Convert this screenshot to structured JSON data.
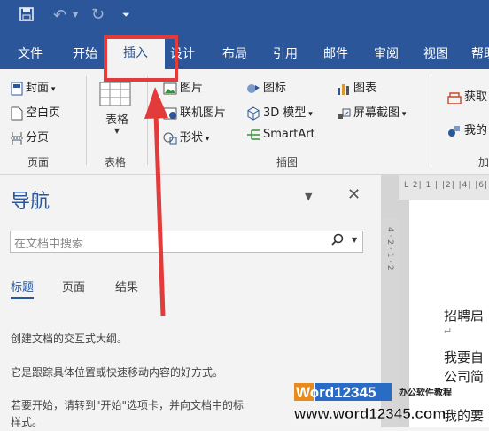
{
  "qat": {
    "save_icon": "save-icon",
    "undo_icon": "undo-icon",
    "redo_icon": "redo-icon",
    "customize_icon": "customize-qat-icon"
  },
  "tabs": [
    "文件",
    "开始",
    "插入",
    "设计",
    "布局",
    "引用",
    "邮件",
    "审阅",
    "视图",
    "帮助"
  ],
  "active_tab": "插入",
  "ribbon": {
    "pages": {
      "cover": "封面",
      "blank": "空白页",
      "break": "分页",
      "label": "页面"
    },
    "tables": {
      "table": "表格",
      "label": "表格"
    },
    "illustrations": {
      "pictures": "图片",
      "online_pictures": "联机图片",
      "shapes": "形状",
      "icons": "图标",
      "models3d": "3D 模型",
      "smartart": "SmartArt",
      "chart": "图表",
      "screenshot": "屏幕截图",
      "label": "插图"
    },
    "addins": {
      "get": "获取",
      "mine": "我的",
      "label": "加"
    }
  },
  "nav": {
    "title": "导航",
    "search_placeholder": "在文档中搜索",
    "tabs": [
      "标题",
      "页面",
      "结果"
    ],
    "active_tab": "标题",
    "line1": "创建文档的交互式大纲。",
    "line2": "它是跟踪具体位置或快速移动内容的好方式。",
    "line3": "若要开始，请转到\"开始\"选项卡，并向文档中的标",
    "line4": "样式。"
  },
  "ruler": {
    "h": "L  2|  1 |    |2|  |4|  |6|",
    "v": "4 · 2 · 1 · 2"
  },
  "doc": {
    "line1": "招聘启",
    "line2": "我要自",
    "line3": "公司简",
    "line4": "我的要"
  },
  "watermark": {
    "brand": "Word12345",
    "sub": "办公软件教程",
    "url": "www.word12345.com"
  },
  "colors": {
    "accent": "#2b579a",
    "highlight": "#e23b3b"
  }
}
